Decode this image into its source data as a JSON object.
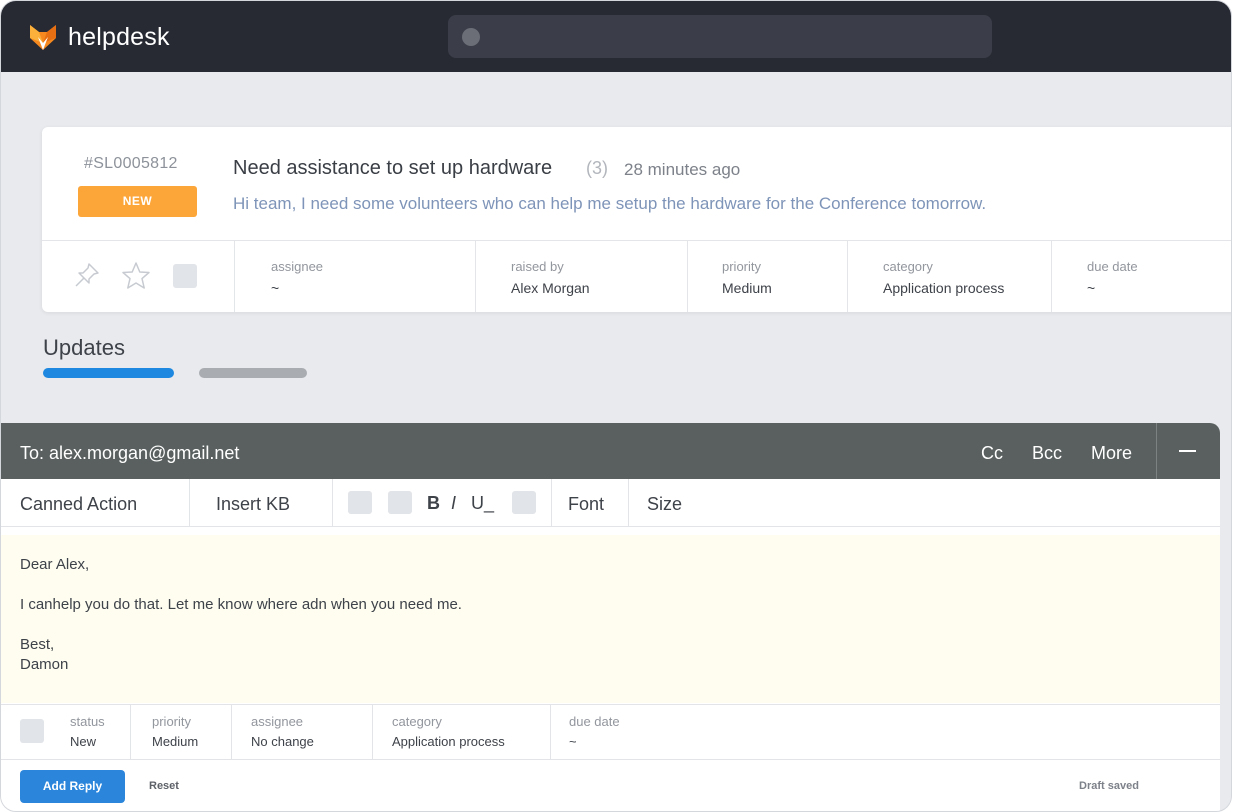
{
  "app": {
    "brand": "helpdesk"
  },
  "ticket": {
    "id": "#SL0005812",
    "status_badge": "NEW",
    "title": "Need assistance to set up hardware",
    "count": "(3)",
    "time": "28 minutes ago",
    "description": "Hi team, I need some volunteers who can help me setup the hardware for the Conference tomorrow.",
    "meta": {
      "assignee": {
        "label": "assignee",
        "value": "~"
      },
      "raised_by": {
        "label": "raised by",
        "value": "Alex Morgan"
      },
      "priority": {
        "label": "priority",
        "value": "Medium"
      },
      "category": {
        "label": "category",
        "value": "Application process"
      },
      "due_date": {
        "label": "due date",
        "value": "~"
      }
    }
  },
  "updates": {
    "title": "Updates"
  },
  "compose": {
    "to": "To: alex.morgan@gmail.net",
    "cc": "Cc",
    "bcc": "Bcc",
    "more": "More",
    "toolbar": {
      "canned_action": "Canned Action",
      "insert_kb": "Insert KB",
      "bold": "B",
      "italic": "I",
      "underline": "U_",
      "font": "Font",
      "size": "Size"
    },
    "body": {
      "greeting": "Dear Alex,",
      "line1": "I canhelp you do that. Let me know where adn when you need me.",
      "signoff": "Best,",
      "signature": "Damon"
    },
    "fields": {
      "status": {
        "label": "status",
        "value": "New"
      },
      "priority": {
        "label": "priority",
        "value": "Medium"
      },
      "assignee": {
        "label": "assignee",
        "value": "No change"
      },
      "category": {
        "label": "category",
        "value": "Application process"
      },
      "due_date": {
        "label": "due date",
        "value": "~"
      }
    },
    "add_reply": "Add Reply",
    "reset": "Reset",
    "draft_status": "Draft saved"
  },
  "colors": {
    "header_bg": "#272a33",
    "badge": "#fca63a",
    "primary": "#2a85db",
    "compose_head": "#59605f",
    "editor_bg": "#fefdf0",
    "tab_active": "#1e88e0"
  }
}
